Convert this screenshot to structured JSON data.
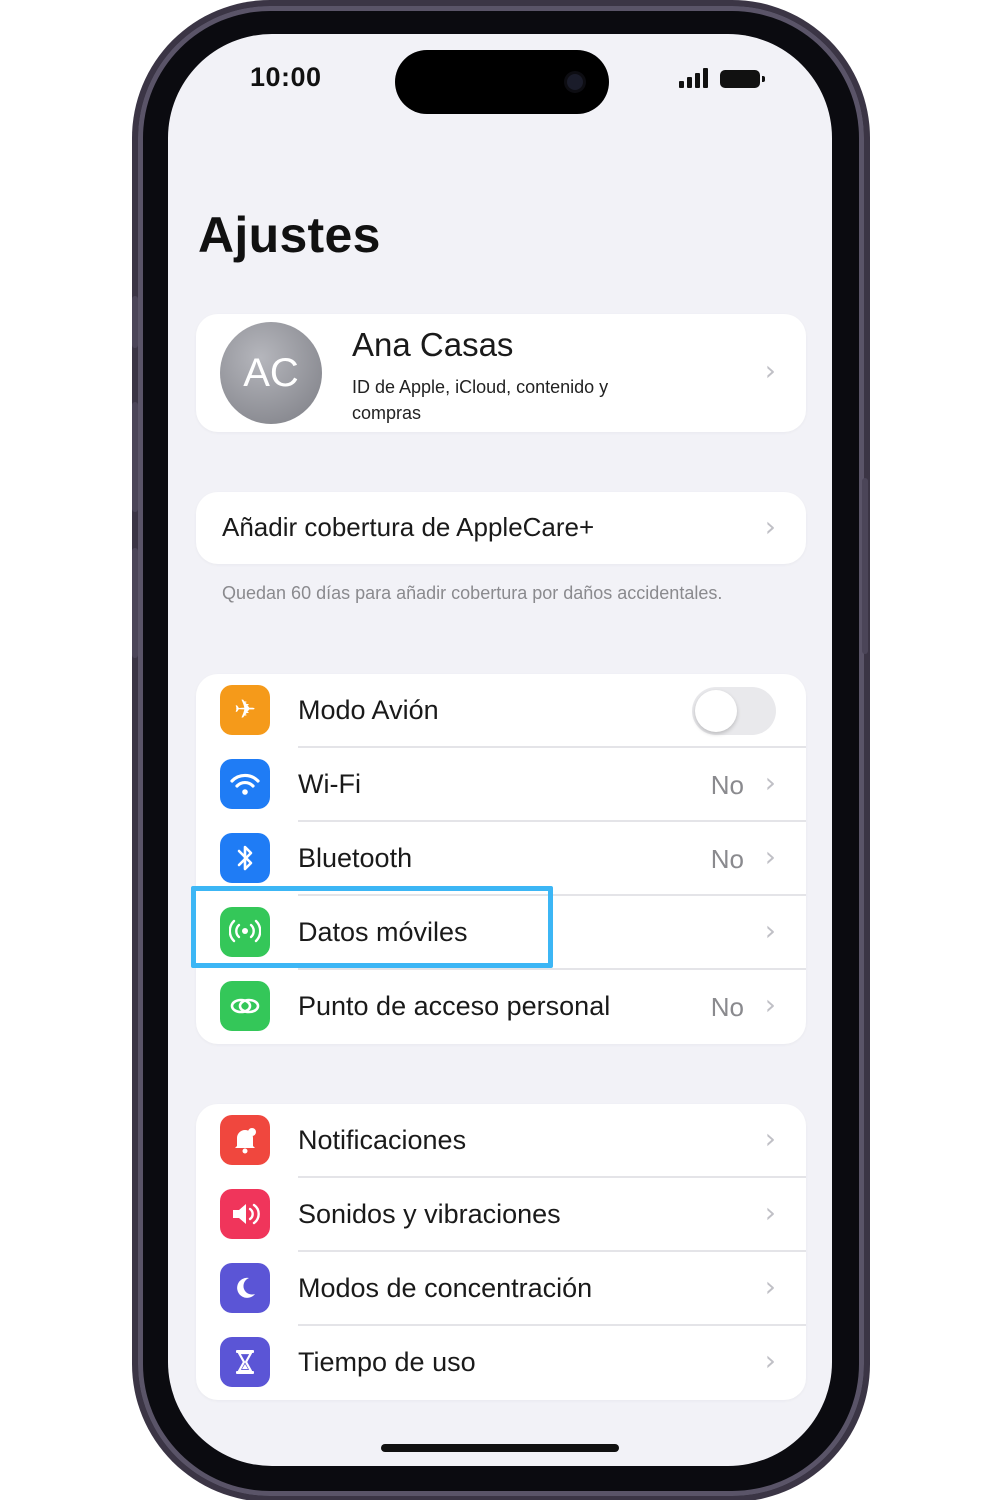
{
  "status_bar": {
    "time": "10:00"
  },
  "page_title": "Ajustes",
  "profile": {
    "initials": "AC",
    "name": "Ana Casas",
    "subtitle": "ID de Apple, iCloud, contenido y compras"
  },
  "applecare": {
    "label": "Añadir cobertura de AppleCare+",
    "note": "Quedan 60 días para añadir cobertura por daños accidentales."
  },
  "connectivity": [
    {
      "label": "Modo Avión",
      "icon": "airplane-icon",
      "color": "#f59a1a",
      "toggle": "off"
    },
    {
      "label": "Wi-Fi",
      "value": "No",
      "icon": "wifi-icon",
      "color": "#1f7cf5"
    },
    {
      "label": "Bluetooth",
      "value": "No",
      "icon": "bluetooth-icon",
      "color": "#1f7cf5"
    },
    {
      "label": "Datos móviles",
      "icon": "cellular-antenna-icon",
      "color": "#34c759",
      "highlighted": true
    },
    {
      "label": "Punto de acceso personal",
      "value": "No",
      "icon": "hotspot-chain-icon",
      "color": "#34c759"
    }
  ],
  "general": [
    {
      "label": "Notificaciones",
      "icon": "notifications-bell-icon",
      "color": "#f0473e"
    },
    {
      "label": "Sonidos y vibraciones",
      "icon": "speaker-icon",
      "color": "#f0355b"
    },
    {
      "label": "Modos de concentración",
      "icon": "moon-icon",
      "color": "#5b55d6"
    },
    {
      "label": "Tiempo de uso",
      "icon": "hourglass-icon",
      "color": "#5b55d6"
    }
  ],
  "highlight_color": "#3cb6f5"
}
